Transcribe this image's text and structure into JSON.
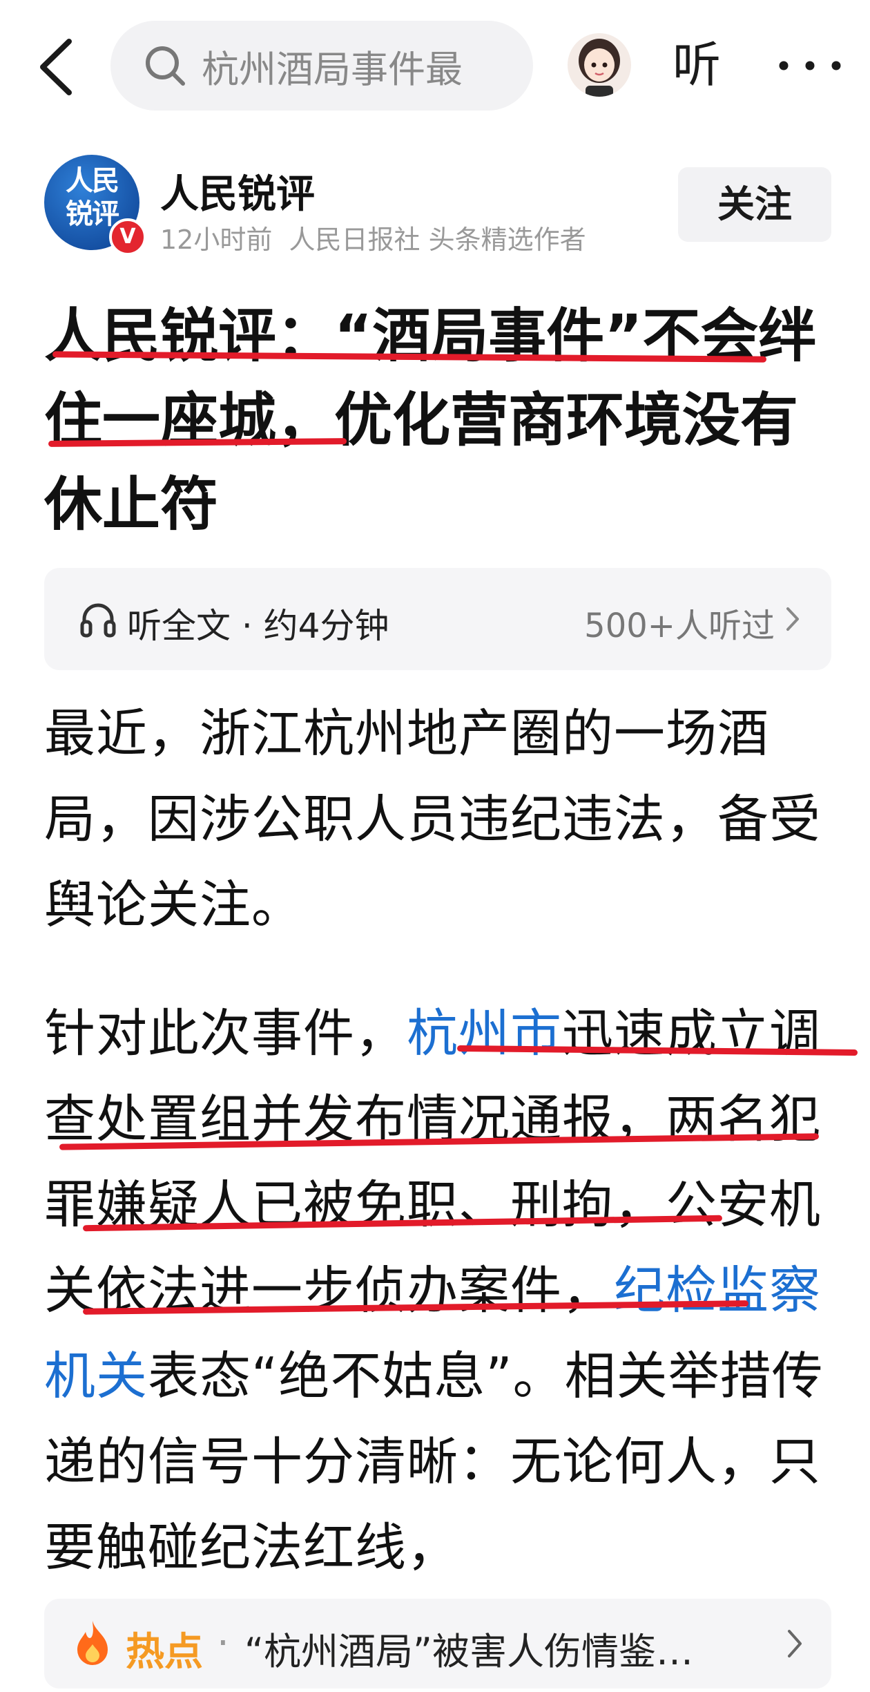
{
  "topbar": {
    "search_text": "杭州酒局事件最",
    "listen_label": "听"
  },
  "author": {
    "logo_text": "人民锐评",
    "verified_mark": "V",
    "name": "人民锐评",
    "time": "12小时前",
    "org": "人民日报社",
    "role": "头条精选作者",
    "follow_label": "关注"
  },
  "article": {
    "headline": "人民锐评：“酒局事件”不会绊住一座城，优化营商环境没有休止符",
    "listen": {
      "label": "听全文 · 约4分钟",
      "count": "500+人听过"
    },
    "para1": "最近，浙江杭州地产圈的一场酒局，因涉公职人员违纪违法，备受舆论关注。",
    "para2": {
      "part1": "针对此次事件，",
      "link1": "杭州市",
      "part2": "迅速成立调查处置组并发布情况通报，两名犯罪嫌疑人已被免职、刑拘，公安机关依法进一步侦办案件，",
      "link2": "纪检监察机关",
      "part3": "表态“绝不姑息”。相关举措传递的信号十分清晰：无论何人，只要触碰纪法红线，"
    }
  },
  "hot": {
    "label": "热点",
    "dot": "·",
    "text": "“杭州酒局”被害人伤情鉴…"
  },
  "colors": {
    "accent_red": "#e21b2a",
    "link_blue": "#1c6fd1",
    "hot_orange": "#f59a23"
  },
  "icons": [
    "chevron-left-icon",
    "search-icon",
    "avatar",
    "more-icon",
    "headphones-icon",
    "chevron-right-icon",
    "fire-icon"
  ]
}
